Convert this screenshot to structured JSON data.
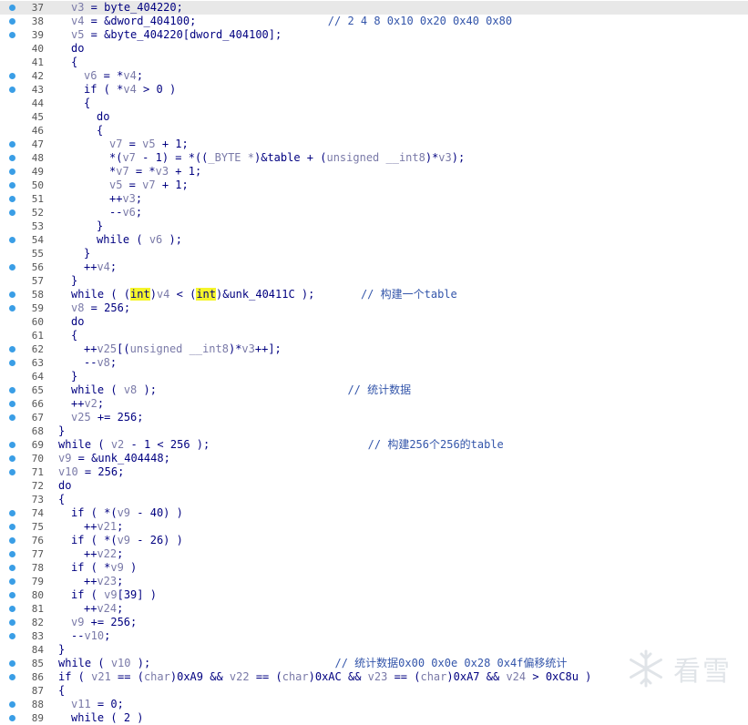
{
  "code_lines": [
    {
      "n": "37",
      "dot": true,
      "hl": true,
      "indent": 1,
      "segs": [
        [
          "v",
          "v3"
        ],
        [
          "p",
          " = "
        ],
        [
          "k",
          "byte_404220"
        ],
        [
          "p",
          ";"
        ]
      ]
    },
    {
      "n": "38",
      "dot": true,
      "indent": 1,
      "segs": [
        [
          "v",
          "v4"
        ],
        [
          "p",
          " = &"
        ],
        [
          "k",
          "dword_404100"
        ],
        [
          "p",
          ";                    "
        ],
        [
          "c",
          "// 2 4 8 0x10 0x20 0x40 0x80"
        ]
      ]
    },
    {
      "n": "39",
      "dot": true,
      "indent": 1,
      "segs": [
        [
          "v",
          "v5"
        ],
        [
          "p",
          " = &"
        ],
        [
          "k",
          "byte_404220"
        ],
        [
          "p",
          "["
        ],
        [
          "k",
          "dword_404100"
        ],
        [
          "p",
          "];"
        ]
      ]
    },
    {
      "n": "40",
      "dot": false,
      "indent": 1,
      "segs": [
        [
          "k",
          "do"
        ]
      ]
    },
    {
      "n": "41",
      "dot": false,
      "indent": 1,
      "segs": [
        [
          "p",
          "{"
        ]
      ]
    },
    {
      "n": "42",
      "dot": true,
      "indent": 2,
      "segs": [
        [
          "v",
          "v6"
        ],
        [
          "p",
          " = *"
        ],
        [
          "v",
          "v4"
        ],
        [
          "p",
          ";"
        ]
      ]
    },
    {
      "n": "43",
      "dot": true,
      "indent": 2,
      "segs": [
        [
          "k",
          "if"
        ],
        [
          "p",
          " ( *"
        ],
        [
          "v",
          "v4"
        ],
        [
          "p",
          " > "
        ],
        [
          "n",
          "0"
        ],
        [
          "p",
          " )"
        ]
      ]
    },
    {
      "n": "44",
      "dot": false,
      "indent": 2,
      "segs": [
        [
          "p",
          "{"
        ]
      ]
    },
    {
      "n": "45",
      "dot": false,
      "indent": 3,
      "segs": [
        [
          "k",
          "do"
        ]
      ]
    },
    {
      "n": "46",
      "dot": false,
      "indent": 3,
      "segs": [
        [
          "p",
          "{"
        ]
      ]
    },
    {
      "n": "47",
      "dot": true,
      "indent": 4,
      "segs": [
        [
          "v",
          "v7"
        ],
        [
          "p",
          " = "
        ],
        [
          "v",
          "v5"
        ],
        [
          "p",
          " + "
        ],
        [
          "n",
          "1"
        ],
        [
          "p",
          ";"
        ]
      ]
    },
    {
      "n": "48",
      "dot": true,
      "indent": 4,
      "segs": [
        [
          "p",
          "*("
        ],
        [
          "v",
          "v7"
        ],
        [
          "p",
          " - "
        ],
        [
          "n",
          "1"
        ],
        [
          "p",
          ") = *(("
        ],
        [
          "g",
          "_BYTE *"
        ],
        [
          "p",
          ")&"
        ],
        [
          "k",
          "table"
        ],
        [
          "p",
          " + ("
        ],
        [
          "g",
          "unsigned __int8"
        ],
        [
          "p",
          ")*"
        ],
        [
          "v",
          "v3"
        ],
        [
          "p",
          ");"
        ]
      ]
    },
    {
      "n": "49",
      "dot": true,
      "indent": 4,
      "segs": [
        [
          "p",
          "*"
        ],
        [
          "v",
          "v7"
        ],
        [
          "p",
          " = *"
        ],
        [
          "v",
          "v3"
        ],
        [
          "p",
          " + "
        ],
        [
          "n",
          "1"
        ],
        [
          "p",
          ";"
        ]
      ]
    },
    {
      "n": "50",
      "dot": true,
      "indent": 4,
      "segs": [
        [
          "v",
          "v5"
        ],
        [
          "p",
          " = "
        ],
        [
          "v",
          "v7"
        ],
        [
          "p",
          " + "
        ],
        [
          "n",
          "1"
        ],
        [
          "p",
          ";"
        ]
      ]
    },
    {
      "n": "51",
      "dot": true,
      "indent": 4,
      "segs": [
        [
          "p",
          "++"
        ],
        [
          "v",
          "v3"
        ],
        [
          "p",
          ";"
        ]
      ]
    },
    {
      "n": "52",
      "dot": true,
      "indent": 4,
      "segs": [
        [
          "p",
          "--"
        ],
        [
          "v",
          "v6"
        ],
        [
          "p",
          ";"
        ]
      ]
    },
    {
      "n": "53",
      "dot": false,
      "indent": 3,
      "segs": [
        [
          "p",
          "}"
        ]
      ]
    },
    {
      "n": "54",
      "dot": true,
      "indent": 3,
      "segs": [
        [
          "k",
          "while"
        ],
        [
          "p",
          " ( "
        ],
        [
          "v",
          "v6"
        ],
        [
          "p",
          " );"
        ]
      ]
    },
    {
      "n": "55",
      "dot": false,
      "indent": 2,
      "segs": [
        [
          "p",
          "}"
        ]
      ]
    },
    {
      "n": "56",
      "dot": true,
      "indent": 2,
      "segs": [
        [
          "p",
          "++"
        ],
        [
          "v",
          "v4"
        ],
        [
          "p",
          ";"
        ]
      ]
    },
    {
      "n": "57",
      "dot": false,
      "indent": 1,
      "segs": [
        [
          "p",
          "}"
        ]
      ]
    },
    {
      "n": "58",
      "dot": true,
      "indent": 1,
      "segs": [
        [
          "k",
          "while"
        ],
        [
          "p",
          " ( ("
        ],
        [
          "h",
          "int"
        ],
        [
          "p",
          ")"
        ],
        [
          "v",
          "v4"
        ],
        [
          "p",
          " < ("
        ],
        [
          "h",
          "int"
        ],
        [
          "p",
          ")&"
        ],
        [
          "k",
          "unk_40411C"
        ],
        [
          "p",
          " );       "
        ],
        [
          "c",
          "// 构建一个table"
        ]
      ]
    },
    {
      "n": "59",
      "dot": true,
      "indent": 1,
      "segs": [
        [
          "v",
          "v8"
        ],
        [
          "p",
          " = "
        ],
        [
          "n",
          "256"
        ],
        [
          "p",
          ";"
        ]
      ]
    },
    {
      "n": "60",
      "dot": false,
      "indent": 1,
      "segs": [
        [
          "k",
          "do"
        ]
      ]
    },
    {
      "n": "61",
      "dot": false,
      "indent": 1,
      "segs": [
        [
          "p",
          "{"
        ]
      ]
    },
    {
      "n": "62",
      "dot": true,
      "indent": 2,
      "segs": [
        [
          "p",
          "++"
        ],
        [
          "v",
          "v25"
        ],
        [
          "p",
          "[("
        ],
        [
          "g",
          "unsigned __int8"
        ],
        [
          "p",
          ")*"
        ],
        [
          "v",
          "v3"
        ],
        [
          "p",
          "++];"
        ]
      ]
    },
    {
      "n": "63",
      "dot": true,
      "indent": 2,
      "segs": [
        [
          "p",
          "--"
        ],
        [
          "v",
          "v8"
        ],
        [
          "p",
          ";"
        ]
      ]
    },
    {
      "n": "64",
      "dot": false,
      "indent": 1,
      "segs": [
        [
          "p",
          "}"
        ]
      ]
    },
    {
      "n": "65",
      "dot": true,
      "indent": 1,
      "segs": [
        [
          "k",
          "while"
        ],
        [
          "p",
          " ( "
        ],
        [
          "v",
          "v8"
        ],
        [
          "p",
          " );                             "
        ],
        [
          "c",
          "// 统计数据"
        ]
      ]
    },
    {
      "n": "66",
      "dot": true,
      "indent": 1,
      "segs": [
        [
          "p",
          "++"
        ],
        [
          "v",
          "v2"
        ],
        [
          "p",
          ";"
        ]
      ]
    },
    {
      "n": "67",
      "dot": true,
      "indent": 1,
      "segs": [
        [
          "v",
          "v25"
        ],
        [
          "p",
          " += "
        ],
        [
          "n",
          "256"
        ],
        [
          "p",
          ";"
        ]
      ]
    },
    {
      "n": "68",
      "dot": false,
      "indent": 0,
      "segs": [
        [
          "p",
          "}"
        ]
      ]
    },
    {
      "n": "69",
      "dot": true,
      "indent": 0,
      "segs": [
        [
          "k",
          "while"
        ],
        [
          "p",
          " ( "
        ],
        [
          "v",
          "v2"
        ],
        [
          "p",
          " - "
        ],
        [
          "n",
          "1"
        ],
        [
          "p",
          " < "
        ],
        [
          "n",
          "256"
        ],
        [
          "p",
          " );                        "
        ],
        [
          "c",
          "// 构建256个256的table"
        ]
      ]
    },
    {
      "n": "70",
      "dot": true,
      "indent": 0,
      "segs": [
        [
          "v",
          "v9"
        ],
        [
          "p",
          " = &"
        ],
        [
          "k",
          "unk_404448"
        ],
        [
          "p",
          ";"
        ]
      ]
    },
    {
      "n": "71",
      "dot": true,
      "indent": 0,
      "segs": [
        [
          "v",
          "v10"
        ],
        [
          "p",
          " = "
        ],
        [
          "n",
          "256"
        ],
        [
          "p",
          ";"
        ]
      ]
    },
    {
      "n": "72",
      "dot": false,
      "indent": 0,
      "segs": [
        [
          "k",
          "do"
        ]
      ]
    },
    {
      "n": "73",
      "dot": false,
      "indent": 0,
      "segs": [
        [
          "p",
          "{"
        ]
      ]
    },
    {
      "n": "74",
      "dot": true,
      "indent": 1,
      "segs": [
        [
          "k",
          "if"
        ],
        [
          "p",
          " ( *("
        ],
        [
          "v",
          "v9"
        ],
        [
          "p",
          " - "
        ],
        [
          "n",
          "40"
        ],
        [
          "p",
          ") )"
        ]
      ]
    },
    {
      "n": "75",
      "dot": true,
      "indent": 2,
      "segs": [
        [
          "p",
          "++"
        ],
        [
          "v",
          "v21"
        ],
        [
          "p",
          ";"
        ]
      ]
    },
    {
      "n": "76",
      "dot": true,
      "indent": 1,
      "segs": [
        [
          "k",
          "if"
        ],
        [
          "p",
          " ( *("
        ],
        [
          "v",
          "v9"
        ],
        [
          "p",
          " - "
        ],
        [
          "n",
          "26"
        ],
        [
          "p",
          ") )"
        ]
      ]
    },
    {
      "n": "77",
      "dot": true,
      "indent": 2,
      "segs": [
        [
          "p",
          "++"
        ],
        [
          "v",
          "v22"
        ],
        [
          "p",
          ";"
        ]
      ]
    },
    {
      "n": "78",
      "dot": true,
      "indent": 1,
      "segs": [
        [
          "k",
          "if"
        ],
        [
          "p",
          " ( *"
        ],
        [
          "v",
          "v9"
        ],
        [
          "p",
          " )"
        ]
      ]
    },
    {
      "n": "79",
      "dot": true,
      "indent": 2,
      "segs": [
        [
          "p",
          "++"
        ],
        [
          "v",
          "v23"
        ],
        [
          "p",
          ";"
        ]
      ]
    },
    {
      "n": "80",
      "dot": true,
      "indent": 1,
      "segs": [
        [
          "k",
          "if"
        ],
        [
          "p",
          " ( "
        ],
        [
          "v",
          "v9"
        ],
        [
          "p",
          "["
        ],
        [
          "n",
          "39"
        ],
        [
          "p",
          "] )"
        ]
      ]
    },
    {
      "n": "81",
      "dot": true,
      "indent": 2,
      "segs": [
        [
          "p",
          "++"
        ],
        [
          "v",
          "v24"
        ],
        [
          "p",
          ";"
        ]
      ]
    },
    {
      "n": "82",
      "dot": true,
      "indent": 1,
      "segs": [
        [
          "v",
          "v9"
        ],
        [
          "p",
          " += "
        ],
        [
          "n",
          "256"
        ],
        [
          "p",
          ";"
        ]
      ]
    },
    {
      "n": "83",
      "dot": true,
      "indent": 1,
      "segs": [
        [
          "p",
          "--"
        ],
        [
          "v",
          "v10"
        ],
        [
          "p",
          ";"
        ]
      ]
    },
    {
      "n": "84",
      "dot": false,
      "indent": 0,
      "segs": [
        [
          "p",
          "}"
        ]
      ]
    },
    {
      "n": "85",
      "dot": true,
      "indent": 0,
      "segs": [
        [
          "k",
          "while"
        ],
        [
          "p",
          " ( "
        ],
        [
          "v",
          "v10"
        ],
        [
          "p",
          " );                            "
        ],
        [
          "c",
          "// 统计数据0x00 0x0e 0x28 0x4f偏移统计"
        ]
      ]
    },
    {
      "n": "86",
      "dot": true,
      "indent": 0,
      "segs": [
        [
          "k",
          "if"
        ],
        [
          "p",
          " ( "
        ],
        [
          "v",
          "v21"
        ],
        [
          "p",
          " == ("
        ],
        [
          "g",
          "char"
        ],
        [
          "p",
          ")"
        ],
        [
          "n",
          "0xA9"
        ],
        [
          "p",
          " && "
        ],
        [
          "v",
          "v22"
        ],
        [
          "p",
          " == ("
        ],
        [
          "g",
          "char"
        ],
        [
          "p",
          ")"
        ],
        [
          "n",
          "0xAC"
        ],
        [
          "p",
          " && "
        ],
        [
          "v",
          "v23"
        ],
        [
          "p",
          " == ("
        ],
        [
          "g",
          "char"
        ],
        [
          "p",
          ")"
        ],
        [
          "n",
          "0xA7"
        ],
        [
          "p",
          " && "
        ],
        [
          "v",
          "v24"
        ],
        [
          "p",
          " > "
        ],
        [
          "n",
          "0xC8u"
        ],
        [
          "p",
          " )"
        ]
      ]
    },
    {
      "n": "87",
      "dot": false,
      "indent": 0,
      "segs": [
        [
          "p",
          "{"
        ]
      ]
    },
    {
      "n": "88",
      "dot": true,
      "indent": 1,
      "segs": [
        [
          "v",
          "v11"
        ],
        [
          "p",
          " = "
        ],
        [
          "n",
          "0"
        ],
        [
          "p",
          ";"
        ]
      ]
    },
    {
      "n": "89",
      "dot": true,
      "indent": 1,
      "segs": [
        [
          "k",
          "while"
        ],
        [
          "p",
          " ( "
        ],
        [
          "n",
          "2"
        ],
        [
          "p",
          " )"
        ]
      ]
    }
  ],
  "watermark": {
    "text": "看雪",
    "icon": "snowflake-icon"
  }
}
